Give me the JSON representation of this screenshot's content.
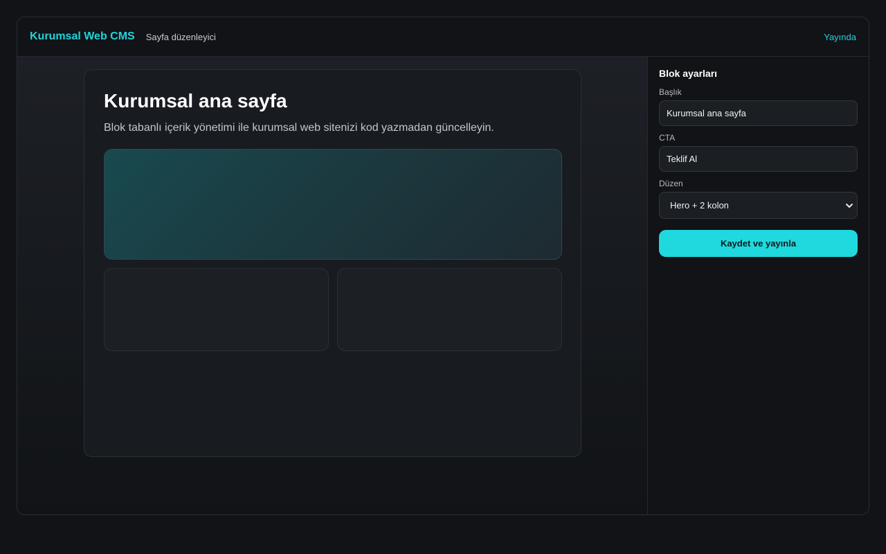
{
  "header": {
    "brand": "Kurumsal Web CMS",
    "subtitle": "Sayfa düzenleyici",
    "status": "Yayında"
  },
  "preview": {
    "title": "Kurumsal ana sayfa",
    "description": "Blok tabanlı içerik yönetimi ile kurumsal web sitenizi kod yazmadan güncelleyin."
  },
  "settings": {
    "title": "Blok ayarları",
    "fields": {
      "heading_label": "Başlık",
      "heading_value": "Kurumsal ana sayfa",
      "cta_label": "CTA",
      "cta_value": "Teklif Al",
      "layout_label": "Düzen",
      "layout_value": "Hero + 2 kolon"
    },
    "save_button": "Kaydet ve yayınla"
  },
  "icons": {
    "layout_select": "chevron-down-icon"
  },
  "colors": {
    "accent": "#22d3dc",
    "button_bg": "#1fd9df",
    "background": "#111316"
  }
}
